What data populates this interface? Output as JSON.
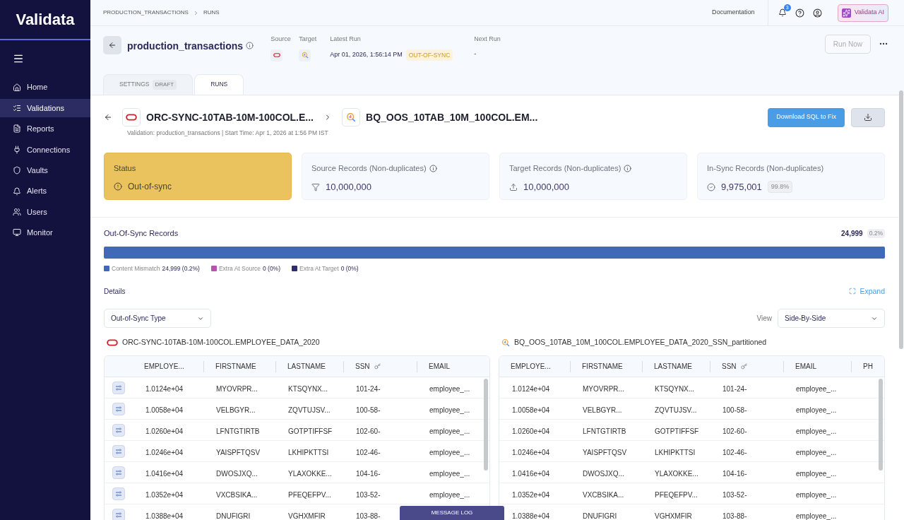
{
  "sidebar": {
    "logo": "Validata",
    "items": [
      {
        "label": "Home",
        "selected": false
      },
      {
        "label": "Validations",
        "selected": true
      },
      {
        "label": "Reports",
        "selected": false
      },
      {
        "label": "Connections",
        "selected": false
      },
      {
        "label": "Vaults",
        "selected": false
      },
      {
        "label": "Alerts",
        "selected": false
      },
      {
        "label": "Users",
        "selected": false
      },
      {
        "label": "Monitor",
        "selected": false
      }
    ]
  },
  "breadcrumb": [
    "PRODUCTION_TRANSACTIONS",
    "RUNS"
  ],
  "topbar": {
    "documentation": "Documentation",
    "notifications": "3",
    "ai_button": "Validata AI"
  },
  "header": {
    "title": "production_transactions",
    "source_label": "Source",
    "target_label": "Target",
    "latest_run_label": "Latest Run",
    "latest_run": "Apr 01, 2026, 1:56:14 PM",
    "latest_status": "OUT-OF-SYNC",
    "next_run_label": "Next Run",
    "next_run": "-",
    "run_now": "Run Now",
    "run_now_disabled": true
  },
  "tabs": [
    {
      "label": "SETTINGS",
      "badge": "DRAFT",
      "selected": false
    },
    {
      "label": "RUNS",
      "selected": true
    }
  ],
  "run": {
    "source": "ORC-SYNC-10TAB-10M-100COL.E...",
    "target": "BQ_OOS_10TAB_10M_100COL.EM...",
    "meta": "Validation: production_transactions | Start Time: Apr 1, 2026 at 1:56 PM IST",
    "download_sql": "Download SQL to Fix"
  },
  "cards": [
    {
      "kind": "status",
      "label": "Status",
      "value": "Out-of-sync"
    },
    {
      "kind": "source",
      "label": "Source Records (Non-duplicates)",
      "value": "10,000,000",
      "info": true
    },
    {
      "kind": "target",
      "label": "Target Records (Non-duplicates)",
      "value": "10,000,000",
      "info": true
    },
    {
      "kind": "insync",
      "label": "In-Sync Records (Non-duplicates)",
      "value": "9,975,001",
      "badge": "99.8%",
      "info": false
    }
  ],
  "out_of_sync": {
    "title": "Out-Of-Sync Records",
    "total": "24,999",
    "percent": "0.2%",
    "level": 1,
    "segments": [
      {
        "label": "Content Mismatch",
        "value": "24,999 (0.2%)",
        "color": "#4169b8"
      },
      {
        "label": "Extra At Source",
        "value": "0 (0%)",
        "color": "#b453b0"
      },
      {
        "label": "Extra At Target",
        "value": "0 (0%)",
        "color": "#2d2f66"
      }
    ]
  },
  "details": {
    "title": "Details",
    "expand": "Expand",
    "filter": "Out-of-Sync Type",
    "view_label": "View",
    "view": "Side-By-Side"
  },
  "tables": [
    {
      "kind": "source",
      "title": "ORC-SYNC-10TAB-10M-100COL.EMPLOYEE_DATA_2020",
      "columns": [
        "EMPLOYE...",
        "FIRSTNAME",
        "LASTNAME",
        "SSN",
        "EMAIL"
      ],
      "rows": [
        [
          "1.0124e+04",
          "MYOVRPR...",
          "KTSQYNX...",
          "101-24-",
          "employee_..."
        ],
        [
          "1.0058e+04",
          "VELBGYR...",
          "ZQVTUJSV...",
          "100-58-",
          "employee_..."
        ],
        [
          "1.0260e+04",
          "LFNTGTIRTB",
          "GOTPTIFFSF",
          "102-60-",
          "employee_..."
        ],
        [
          "1.0246e+04",
          "YAISPFTQSV",
          "LKHIPKTTSI",
          "102-46-",
          "employee_..."
        ],
        [
          "1.0416e+04",
          "DWOSJXQ...",
          "YLAXOKKE...",
          "104-16-",
          "employee_..."
        ],
        [
          "1.0352e+04",
          "VXCBSIKA...",
          "PFEQEFPV...",
          "103-52-",
          "employee_..."
        ],
        [
          "1.0388e+04",
          "DNUFIGRI",
          "VGHXMFIR",
          "103-88-"
        ]
      ]
    },
    {
      "kind": "target",
      "title": "BQ_OOS_10TAB_10M_100COL.EMPLOYEE_DATA_2020_SSN_partitioned",
      "columns": [
        "EMPLOYE...",
        "FIRSTNAME",
        "LASTNAME",
        "SSN",
        "EMAIL",
        "PH"
      ],
      "rows": [
        [
          "1.0124e+04",
          "MYOVRPR...",
          "KTSQYNX...",
          "101-24-",
          "employee_..."
        ],
        [
          "1.0058e+04",
          "VELBGYR...",
          "ZQVTUJSV...",
          "100-58-",
          "employee_..."
        ],
        [
          "1.0260e+04",
          "LFNTGTIRTB",
          "GOTPTIFFSF",
          "102-60-",
          "employee_..."
        ],
        [
          "1.0246e+04",
          "YAISPFTQSV",
          "LKHIPKTTSI",
          "102-46-",
          "employee_..."
        ],
        [
          "1.0416e+04",
          "DWOSJXQ...",
          "YLAXOKKE...",
          "104-16-",
          "employee_..."
        ],
        [
          "1.0352e+04",
          "VXCBSIKA...",
          "PFEQEFPV...",
          "103-52-",
          "employee_..."
        ],
        [
          "1.0388e+04",
          "DNUFIGRI",
          "VGHXMFIR",
          "103-88-",
          "employee_..."
        ]
      ]
    }
  ],
  "message_log": "MESSAGE LOG"
}
